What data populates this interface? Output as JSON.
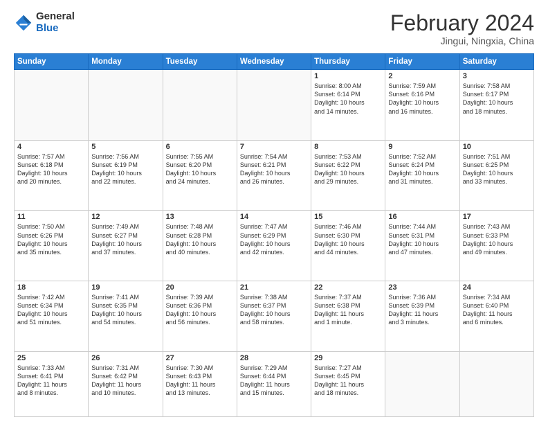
{
  "header": {
    "logo_general": "General",
    "logo_blue": "Blue",
    "month_year": "February 2024",
    "location": "Jingui, Ningxia, China"
  },
  "days_of_week": [
    "Sunday",
    "Monday",
    "Tuesday",
    "Wednesday",
    "Thursday",
    "Friday",
    "Saturday"
  ],
  "weeks": [
    [
      {
        "day": "",
        "info": ""
      },
      {
        "day": "",
        "info": ""
      },
      {
        "day": "",
        "info": ""
      },
      {
        "day": "",
        "info": ""
      },
      {
        "day": "1",
        "info": "Sunrise: 8:00 AM\nSunset: 6:14 PM\nDaylight: 10 hours\nand 14 minutes."
      },
      {
        "day": "2",
        "info": "Sunrise: 7:59 AM\nSunset: 6:16 PM\nDaylight: 10 hours\nand 16 minutes."
      },
      {
        "day": "3",
        "info": "Sunrise: 7:58 AM\nSunset: 6:17 PM\nDaylight: 10 hours\nand 18 minutes."
      }
    ],
    [
      {
        "day": "4",
        "info": "Sunrise: 7:57 AM\nSunset: 6:18 PM\nDaylight: 10 hours\nand 20 minutes."
      },
      {
        "day": "5",
        "info": "Sunrise: 7:56 AM\nSunset: 6:19 PM\nDaylight: 10 hours\nand 22 minutes."
      },
      {
        "day": "6",
        "info": "Sunrise: 7:55 AM\nSunset: 6:20 PM\nDaylight: 10 hours\nand 24 minutes."
      },
      {
        "day": "7",
        "info": "Sunrise: 7:54 AM\nSunset: 6:21 PM\nDaylight: 10 hours\nand 26 minutes."
      },
      {
        "day": "8",
        "info": "Sunrise: 7:53 AM\nSunset: 6:22 PM\nDaylight: 10 hours\nand 29 minutes."
      },
      {
        "day": "9",
        "info": "Sunrise: 7:52 AM\nSunset: 6:24 PM\nDaylight: 10 hours\nand 31 minutes."
      },
      {
        "day": "10",
        "info": "Sunrise: 7:51 AM\nSunset: 6:25 PM\nDaylight: 10 hours\nand 33 minutes."
      }
    ],
    [
      {
        "day": "11",
        "info": "Sunrise: 7:50 AM\nSunset: 6:26 PM\nDaylight: 10 hours\nand 35 minutes."
      },
      {
        "day": "12",
        "info": "Sunrise: 7:49 AM\nSunset: 6:27 PM\nDaylight: 10 hours\nand 37 minutes."
      },
      {
        "day": "13",
        "info": "Sunrise: 7:48 AM\nSunset: 6:28 PM\nDaylight: 10 hours\nand 40 minutes."
      },
      {
        "day": "14",
        "info": "Sunrise: 7:47 AM\nSunset: 6:29 PM\nDaylight: 10 hours\nand 42 minutes."
      },
      {
        "day": "15",
        "info": "Sunrise: 7:46 AM\nSunset: 6:30 PM\nDaylight: 10 hours\nand 44 minutes."
      },
      {
        "day": "16",
        "info": "Sunrise: 7:44 AM\nSunset: 6:31 PM\nDaylight: 10 hours\nand 47 minutes."
      },
      {
        "day": "17",
        "info": "Sunrise: 7:43 AM\nSunset: 6:33 PM\nDaylight: 10 hours\nand 49 minutes."
      }
    ],
    [
      {
        "day": "18",
        "info": "Sunrise: 7:42 AM\nSunset: 6:34 PM\nDaylight: 10 hours\nand 51 minutes."
      },
      {
        "day": "19",
        "info": "Sunrise: 7:41 AM\nSunset: 6:35 PM\nDaylight: 10 hours\nand 54 minutes."
      },
      {
        "day": "20",
        "info": "Sunrise: 7:39 AM\nSunset: 6:36 PM\nDaylight: 10 hours\nand 56 minutes."
      },
      {
        "day": "21",
        "info": "Sunrise: 7:38 AM\nSunset: 6:37 PM\nDaylight: 10 hours\nand 58 minutes."
      },
      {
        "day": "22",
        "info": "Sunrise: 7:37 AM\nSunset: 6:38 PM\nDaylight: 11 hours\nand 1 minute."
      },
      {
        "day": "23",
        "info": "Sunrise: 7:36 AM\nSunset: 6:39 PM\nDaylight: 11 hours\nand 3 minutes."
      },
      {
        "day": "24",
        "info": "Sunrise: 7:34 AM\nSunset: 6:40 PM\nDaylight: 11 hours\nand 6 minutes."
      }
    ],
    [
      {
        "day": "25",
        "info": "Sunrise: 7:33 AM\nSunset: 6:41 PM\nDaylight: 11 hours\nand 8 minutes."
      },
      {
        "day": "26",
        "info": "Sunrise: 7:31 AM\nSunset: 6:42 PM\nDaylight: 11 hours\nand 10 minutes."
      },
      {
        "day": "27",
        "info": "Sunrise: 7:30 AM\nSunset: 6:43 PM\nDaylight: 11 hours\nand 13 minutes."
      },
      {
        "day": "28",
        "info": "Sunrise: 7:29 AM\nSunset: 6:44 PM\nDaylight: 11 hours\nand 15 minutes."
      },
      {
        "day": "29",
        "info": "Sunrise: 7:27 AM\nSunset: 6:45 PM\nDaylight: 11 hours\nand 18 minutes."
      },
      {
        "day": "",
        "info": ""
      },
      {
        "day": "",
        "info": ""
      }
    ]
  ]
}
